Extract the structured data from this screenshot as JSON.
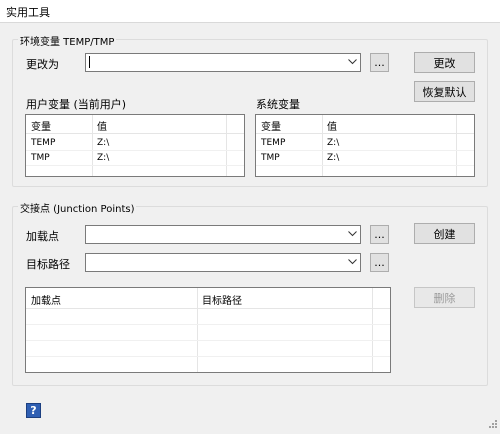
{
  "window": {
    "title": "实用工具"
  },
  "env_group": {
    "legend": "环境变量 TEMP/TMP",
    "change_to_label": "更改为",
    "change_to_value": "",
    "browse_label": "...",
    "change_button": "更改",
    "restore_button": "恢复默认",
    "user_vars": {
      "title": "用户变量 (当前用户)",
      "columns": [
        "变量",
        "值"
      ],
      "rows": [
        {
          "name": "TEMP",
          "value": "Z:\\"
        },
        {
          "name": "TMP",
          "value": "Z:\\"
        }
      ]
    },
    "system_vars": {
      "title": "系统变量",
      "columns": [
        "变量",
        "值"
      ],
      "rows": [
        {
          "name": "TEMP",
          "value": "Z:\\"
        },
        {
          "name": "TMP",
          "value": "Z:\\"
        }
      ]
    }
  },
  "junction_group": {
    "legend": "交接点 (Junction Points)",
    "mount_label": "加载点",
    "mount_value": "",
    "target_label": "目标路径",
    "target_value": "",
    "browse_label": "...",
    "create_button": "创建",
    "delete_button": "删除",
    "list_columns": [
      "加载点",
      "目标路径"
    ]
  },
  "help": {
    "label": "?"
  },
  "colors": {
    "help_blue": "#2f5fb3",
    "border": "#7a7a7a",
    "button_bg": "#e1e1e1"
  }
}
